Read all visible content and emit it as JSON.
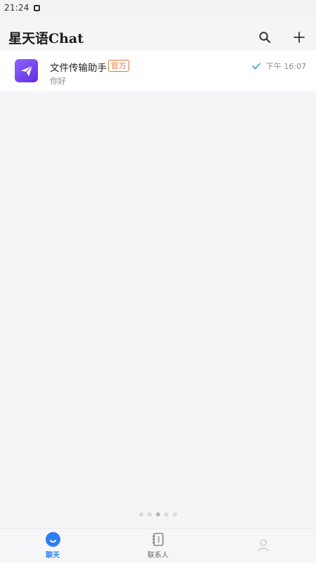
{
  "status_bar": {
    "time": "21:24"
  },
  "header": {
    "title": "星天语Chat"
  },
  "chats": [
    {
      "name": "文件传输助手",
      "badge": "官方",
      "preview": "你好",
      "time": "下午 16:07"
    }
  ],
  "nav": {
    "tabs": [
      {
        "label": "聊天",
        "icon": "chat-bubble-icon",
        "active": true
      },
      {
        "label": "联系人",
        "icon": "contacts-icon",
        "active": false
      },
      {
        "label": "",
        "icon": "me-icon",
        "active": false
      }
    ]
  },
  "colors": {
    "accent": "#2d7ef0",
    "badge": "#e8773a",
    "avatar_gradient_start": "#8f63ff",
    "avatar_gradient_end": "#5f2fe0"
  },
  "page_indicator": {
    "count": 5,
    "active_index": 2
  }
}
